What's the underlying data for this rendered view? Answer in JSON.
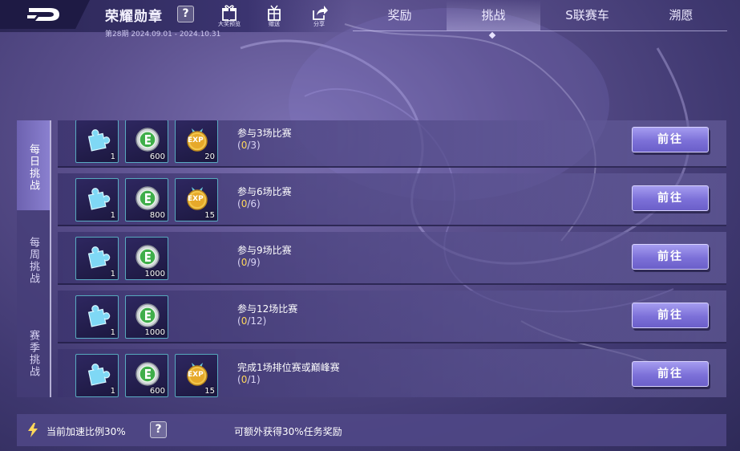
{
  "header": {
    "title": "荣耀勋章",
    "help": "?",
    "period": "第28期 2024.09.01 - 2024.10.31",
    "icons": [
      {
        "icon": "gift-icon",
        "label": "大奖预览"
      },
      {
        "icon": "present-icon",
        "label": "赠送"
      },
      {
        "icon": "share-icon",
        "label": "分享"
      }
    ]
  },
  "tabs": [
    {
      "label": "奖励"
    },
    {
      "label": "挑战"
    },
    {
      "label": "S联赛车"
    },
    {
      "label": "溯愿"
    }
  ],
  "active_tab": "挑战",
  "sidenav": [
    {
      "label": "每日挑战"
    },
    {
      "label": "每周挑战"
    },
    {
      "label": "赛季挑战"
    }
  ],
  "tasks": [
    {
      "name": "参与3场比赛",
      "progress_current": "0",
      "progress_total": "3",
      "rewards": [
        {
          "type": "puzzle-icon",
          "count": "1"
        },
        {
          "type": "coin-icon",
          "count": "600"
        },
        {
          "type": "exp-icon",
          "count": "20"
        }
      ],
      "button": "前往"
    },
    {
      "name": "参与6场比赛",
      "progress_current": "0",
      "progress_total": "6",
      "rewards": [
        {
          "type": "puzzle-icon",
          "count": "1"
        },
        {
          "type": "coin-icon",
          "count": "800"
        },
        {
          "type": "exp-icon",
          "count": "15"
        }
      ],
      "button": "前往"
    },
    {
      "name": "参与9场比赛",
      "progress_current": "0",
      "progress_total": "9",
      "rewards": [
        {
          "type": "puzzle-icon",
          "count": "1"
        },
        {
          "type": "coin-icon",
          "count": "1000"
        }
      ],
      "button": "前往"
    },
    {
      "name": "参与12场比赛",
      "progress_current": "0",
      "progress_total": "12",
      "rewards": [
        {
          "type": "puzzle-icon",
          "count": "1"
        },
        {
          "type": "coin-icon",
          "count": "1000"
        }
      ],
      "button": "前往"
    },
    {
      "name": "完成1场排位赛或巅峰赛",
      "progress_current": "0",
      "progress_total": "1",
      "rewards": [
        {
          "type": "puzzle-icon",
          "count": "1"
        },
        {
          "type": "coin-icon",
          "count": "600"
        },
        {
          "type": "exp-icon",
          "count": "15"
        }
      ],
      "button": "前往"
    }
  ],
  "footer": {
    "rate_text": "当前加速比例30%",
    "help": "?",
    "extra_text": "可额外获得30%任务奖励"
  },
  "colors": {
    "accent": "#7c70d8",
    "progress_current": "#ffd75a",
    "reward_border": "#6ee6f0"
  }
}
